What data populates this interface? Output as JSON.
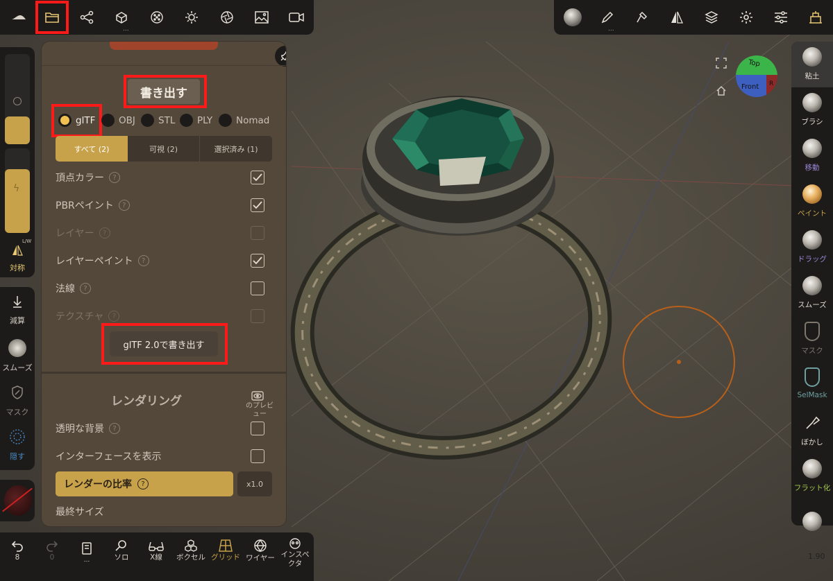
{
  "colors": {
    "accent": "#c8a24a",
    "highlight": "#ff1a1a",
    "panel_bg": "#54483b",
    "bar_bg": "#1c1b1a",
    "selmask": "#6fa0a0",
    "flat": "#a4c94a",
    "purple": "#9b88d8"
  },
  "top_left_icons": [
    "nomad-logo-icon",
    "folder-icon",
    "scene-graph-icon",
    "topology-icon",
    "matcap-icon",
    "light-icon",
    "camera-aperture-icon",
    "image-icon",
    "video-icon"
  ],
  "top_right_icons": [
    "material-sphere-icon",
    "pen-icon",
    "hammer-icon",
    "symmetry-icon",
    "layers-icon",
    "gear-icon",
    "sliders-icon",
    "scene-icon"
  ],
  "left_strip": {
    "symmetry": {
      "label": "対称",
      "badge": "L/W"
    },
    "subtract": {
      "label": "減算"
    },
    "smooth": {
      "label": "スムーズ"
    },
    "mask": {
      "label": "マスク"
    },
    "hide": {
      "label": "隠す"
    }
  },
  "panel": {
    "export_title": "書き出す",
    "formats": [
      "glTF",
      "OBJ",
      "STL",
      "PLY",
      "Nomad"
    ],
    "selected_format": "glTF",
    "segments": [
      "すべて (2)",
      "可視 (2)",
      "選択済み (1)"
    ],
    "options": [
      {
        "label": "頂点カラー",
        "checked": true,
        "enabled": true
      },
      {
        "label": "PBRペイント",
        "checked": true,
        "enabled": true
      },
      {
        "label": "レイヤー",
        "checked": false,
        "enabled": false
      },
      {
        "label": "レイヤーペイント",
        "checked": true,
        "enabled": true
      },
      {
        "label": "法線",
        "checked": false,
        "enabled": true
      },
      {
        "label": "テクスチャ",
        "checked": false,
        "enabled": false
      }
    ],
    "export_button": "glTF 2.0で書き出す",
    "rendering_title": "レンダリング",
    "preview_label": "のプレビュー",
    "render_options": [
      {
        "label": "透明な背景",
        "checked": false
      },
      {
        "label": "インターフェースを表示",
        "checked": false
      }
    ],
    "render_ratio_label": "レンダーの比率",
    "render_ratio_value": "x1.0",
    "final_size_label": "最終サイズ"
  },
  "gizmo": {
    "top": "Top",
    "front": "Front",
    "right": "R"
  },
  "right_tools": [
    {
      "label": "粘土",
      "color": "#e0dad0"
    },
    {
      "label": "ブラシ",
      "color": "#e0dad0"
    },
    {
      "label": "移動",
      "color": "#9b88d8"
    },
    {
      "label": "ペイント",
      "color": "#c8a24a"
    },
    {
      "label": "ドラッグ",
      "color": "#9b88d8"
    },
    {
      "label": "スムーズ",
      "color": "#e0dad0"
    },
    {
      "label": "マスク",
      "color": "#7d776e"
    },
    {
      "label": "SelMask",
      "color": "#6fa0a0"
    },
    {
      "label": "ぼかし",
      "color": "#e0dad0"
    },
    {
      "label": "フラット化",
      "color": "#a4c94a"
    }
  ],
  "bottom_bar": {
    "undo_count": "8",
    "redo_count": "0",
    "items": [
      {
        "label": "...",
        "icon": "book-icon"
      },
      {
        "label": "ソロ",
        "icon": "search-icon"
      },
      {
        "label": "X線",
        "icon": "glasses-icon"
      },
      {
        "label": "ボクセル",
        "icon": "voxel-icon"
      },
      {
        "label": "グリッド",
        "icon": "grid-icon"
      },
      {
        "label": "ワイヤー",
        "icon": "wireframe-icon"
      },
      {
        "label": "インスペクタ",
        "icon": "inspector-icon"
      }
    ]
  },
  "version": "1.90"
}
